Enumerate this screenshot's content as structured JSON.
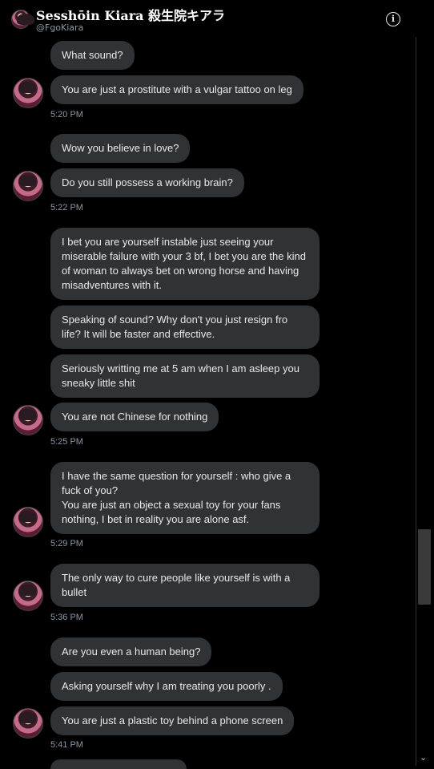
{
  "header": {
    "name": "Sesshōin Kiara 殺生院キアラ",
    "handle": "@FgoKiara",
    "info_icon": "i"
  },
  "messages": [
    {
      "text": "What sound?"
    },
    {
      "text": "You are just a prostitute with a vulgar tattoo on leg"
    },
    {
      "text": "Wow you believe in love?"
    },
    {
      "text": "Do you still possess a working brain?"
    },
    {
      "text": "I bet you are yourself instable just seeing your miserable failure with your 3 bf, I bet you are the kind of woman to always bet on wrong horse and having misadventures with it."
    },
    {
      "text": "Speaking of sound? Why don't you just resign fro life? It will be faster and effective."
    },
    {
      "text": "Seriously writting me at 5 am when I am asleep you sneaky little shit"
    },
    {
      "text": "You are not Chinese for nothing"
    },
    {
      "text": "I have the same question for yourself : who give a fuck of you?\nYou are just an object a sexual toy for your fans nothing, I bet in reality you are alone asf."
    },
    {
      "text": "The only way to cure people like yourself is with a bullet"
    },
    {
      "text": "Are you even a human being?"
    },
    {
      "text": "Asking yourself why I am treating  you poorly ."
    },
    {
      "text": "You are just a plastic toy behind a phone screen"
    }
  ],
  "timestamps": [
    "5:20 PM",
    "5:22 PM",
    "5:25 PM",
    "5:29 PM",
    "5:36 PM",
    "5:41 PM"
  ]
}
